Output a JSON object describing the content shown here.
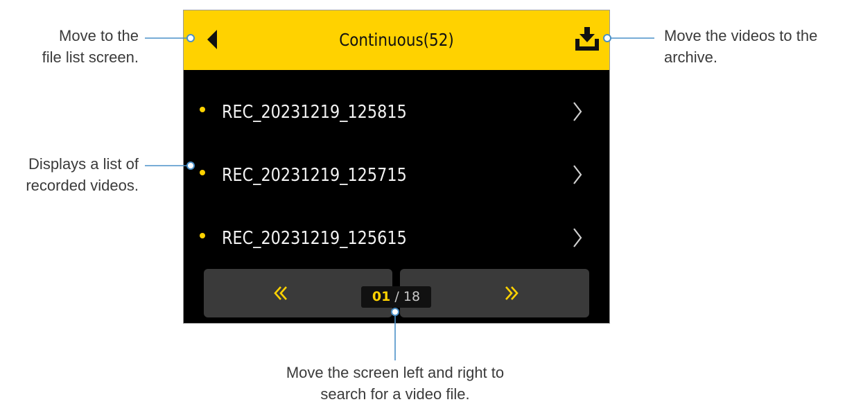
{
  "screen": {
    "title": "Continuous(52)",
    "back_icon": "back-arrow-icon",
    "download_icon": "download-icon",
    "files": [
      {
        "name": "REC_20231219_125815"
      },
      {
        "name": "REC_20231219_125715"
      },
      {
        "name": "REC_20231219_125615"
      }
    ],
    "pager": {
      "current": "01",
      "separator": "/",
      "total": "18",
      "prev_icon": "double-chevron-left-icon",
      "next_icon": "double-chevron-right-icon"
    }
  },
  "callouts": {
    "back": [
      "Move to the",
      "file list screen."
    ],
    "download": [
      "Move the videos to the",
      "archive."
    ],
    "list": [
      "Displays a list of",
      "recorded videos."
    ],
    "pager": [
      "Move the screen left and right to",
      "search for a video file."
    ]
  },
  "colors": {
    "accent": "#FFD200",
    "screen_bg": "#000000",
    "pager_bg": "#3A3A3A",
    "leader_line": "#4A90C8"
  }
}
